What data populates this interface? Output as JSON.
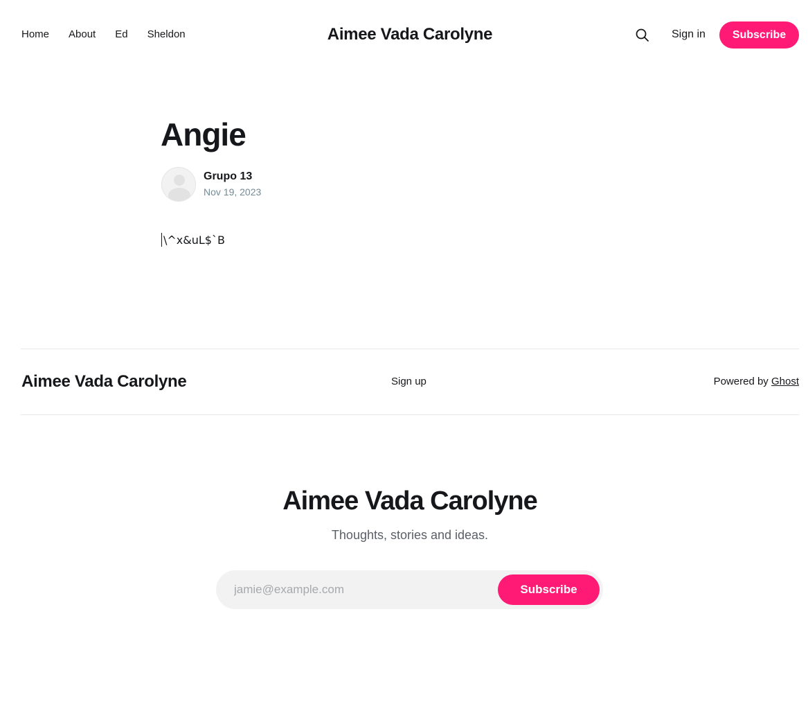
{
  "header": {
    "nav": [
      {
        "label": "Home"
      },
      {
        "label": "About"
      },
      {
        "label": "Ed"
      },
      {
        "label": "Sheldon"
      }
    ],
    "site_title": "Aimee Vada Carolyne",
    "search_icon": "search-icon",
    "signin_label": "Sign in",
    "subscribe_label": "Subscribe",
    "accent_color": "#ff1a75"
  },
  "article": {
    "title": "Angie",
    "author": "Grupo 13",
    "date": "Nov 19, 2023",
    "body": "\\^x&uL$`B",
    "avatar_icon": "avatar-placeholder-icon"
  },
  "footer": {
    "title": "Aimee Vada Carolyne",
    "signup_label": "Sign up",
    "powered_prefix": "Powered by",
    "powered_link": "Ghost"
  },
  "cta": {
    "title": "Aimee Vada Carolyne",
    "description": "Thoughts, stories and ideas.",
    "email_placeholder": "jamie@example.com",
    "email_value": "",
    "subscribe_label": "Subscribe"
  }
}
